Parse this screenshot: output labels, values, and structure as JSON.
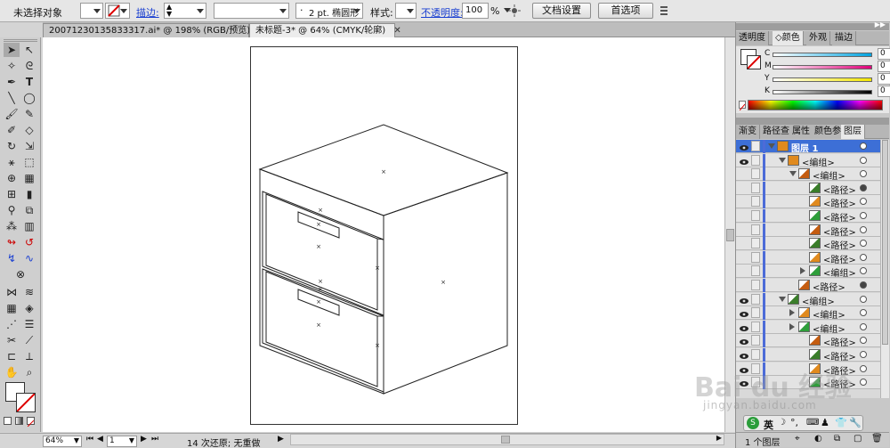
{
  "control_bar": {
    "selection_status": "未选择对象",
    "stroke_label": "描边:",
    "stroke_weight": "",
    "brush_value": "2 pt. 椭圆形",
    "style_label": "样式:",
    "opacity_label": "不透明度:",
    "opacity_value": "100",
    "opacity_unit": "%",
    "doc_settings_button": "文档设置",
    "preferences_button": "首选项"
  },
  "tabs": [
    {
      "label": "20071230135833317.ai* @ 198% (RGB/预览)",
      "active": false
    },
    {
      "label": "未标题-3* @ 64% (CMYK/轮廓)",
      "active": true
    }
  ],
  "color_panel": {
    "tabs": [
      "透明度",
      "颜色",
      "外观",
      "描边"
    ],
    "active_tab": "颜色",
    "sliders": [
      {
        "label": "C",
        "value": "0",
        "unit": "%",
        "color": "#00a3e0"
      },
      {
        "label": "M",
        "value": "0",
        "unit": "%",
        "color": "#e0007a"
      },
      {
        "label": "Y",
        "value": "0",
        "unit": "%",
        "color": "#f3e600"
      },
      {
        "label": "K",
        "value": "0",
        "unit": "%",
        "color": "#000000"
      }
    ]
  },
  "layers_panel": {
    "tabs": [
      "渐变",
      "路径查",
      "属性",
      "颜色参",
      "图层"
    ],
    "active_tab": "图层",
    "rows": [
      {
        "name": "图层 1",
        "indent": 0,
        "tri": "down",
        "eye": true,
        "selected": true,
        "target_filled": false
      },
      {
        "name": "<编组>",
        "indent": 1,
        "tri": "down",
        "eye": true,
        "selected": false,
        "target_filled": false
      },
      {
        "name": "<编组>",
        "indent": 2,
        "tri": "down",
        "eye": false,
        "selected": false,
        "target_filled": false
      },
      {
        "name": "<路径>",
        "indent": 3,
        "tri": "none",
        "eye": false,
        "selected": false,
        "target_filled": true
      },
      {
        "name": "<路径>",
        "indent": 3,
        "tri": "none",
        "eye": false,
        "selected": false,
        "target_filled": false
      },
      {
        "name": "<路径>",
        "indent": 3,
        "tri": "none",
        "eye": false,
        "selected": false,
        "target_filled": false
      },
      {
        "name": "<路径>",
        "indent": 3,
        "tri": "none",
        "eye": false,
        "selected": false,
        "target_filled": false
      },
      {
        "name": "<路径>",
        "indent": 3,
        "tri": "none",
        "eye": false,
        "selected": false,
        "target_filled": false
      },
      {
        "name": "<路径>",
        "indent": 3,
        "tri": "none",
        "eye": false,
        "selected": false,
        "target_filled": false
      },
      {
        "name": "<编组>",
        "indent": 3,
        "tri": "right",
        "eye": false,
        "selected": false,
        "target_filled": false
      },
      {
        "name": "<路径>",
        "indent": 2,
        "tri": "none",
        "eye": false,
        "selected": false,
        "target_filled": true
      },
      {
        "name": "<编组>",
        "indent": 1,
        "tri": "down",
        "eye": true,
        "selected": false,
        "target_filled": false
      },
      {
        "name": "<编组>",
        "indent": 2,
        "tri": "right",
        "eye": true,
        "selected": false,
        "target_filled": false
      },
      {
        "name": "<编组>",
        "indent": 2,
        "tri": "right",
        "eye": true,
        "selected": false,
        "target_filled": false
      },
      {
        "name": "<路径>",
        "indent": 3,
        "tri": "none",
        "eye": true,
        "selected": false,
        "target_filled": false
      },
      {
        "name": "<路径>",
        "indent": 3,
        "tri": "none",
        "eye": true,
        "selected": false,
        "target_filled": false
      },
      {
        "name": "<路径>",
        "indent": 3,
        "tri": "none",
        "eye": true,
        "selected": false,
        "target_filled": false
      },
      {
        "name": "<路径>",
        "indent": 3,
        "tri": "none",
        "eye": true,
        "selected": false,
        "target_filled": false
      }
    ],
    "footer_count": "1 个图层"
  },
  "status_bar": {
    "zoom": "64%",
    "page": "1",
    "undo_status": "14 次还原; 无重做"
  },
  "ime_label": "英",
  "watermark": {
    "brand": "Bai du 经验",
    "url": "jingyan.baidu.com"
  }
}
